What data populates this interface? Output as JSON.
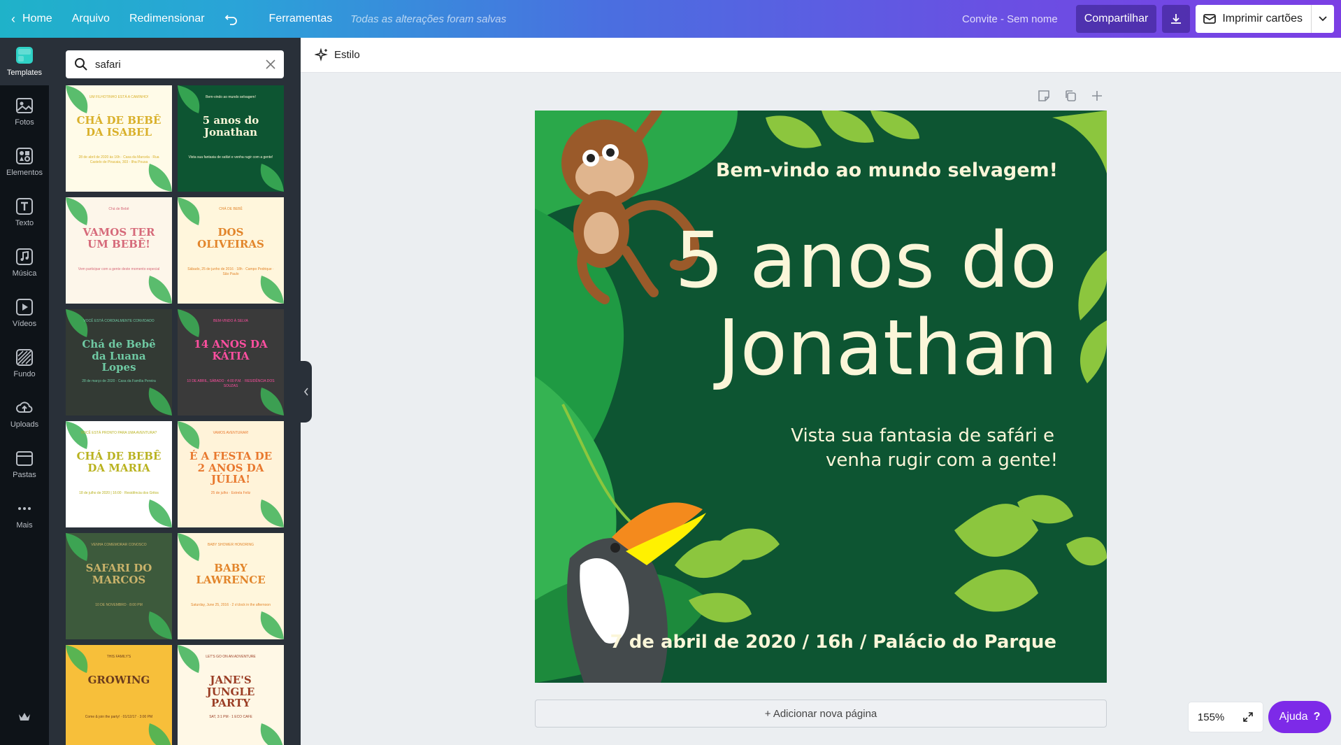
{
  "topbar": {
    "home": "Home",
    "arquivo": "Arquivo",
    "redimensionar": "Redimensionar",
    "ferramentas": "Ferramentas",
    "saved": "Todas as alterações foram salvas",
    "docname": "Convite - Sem nome",
    "share": "Compartilhar",
    "print": "Imprimir cartões"
  },
  "rail": [
    {
      "label": "Templates",
      "icon": "templates-icon"
    },
    {
      "label": "Fotos",
      "icon": "photos-icon"
    },
    {
      "label": "Elementos",
      "icon": "elements-icon"
    },
    {
      "label": "Texto",
      "icon": "text-icon"
    },
    {
      "label": "Música",
      "icon": "music-icon"
    },
    {
      "label": "Vídeos",
      "icon": "video-icon"
    },
    {
      "label": "Fundo",
      "icon": "background-icon"
    },
    {
      "label": "Uploads",
      "icon": "upload-icon"
    },
    {
      "label": "Pastas",
      "icon": "folder-icon"
    },
    {
      "label": "Mais",
      "icon": "more-icon"
    }
  ],
  "search": {
    "value": "safari"
  },
  "thumbs": [
    {
      "title": "CHÁ DE BEBÊ DA ISABEL",
      "sub": "28 de abril de 2020 às 16h · Casa da Marcela · Rua Castelo de Piracaia, 303 - Ilha Pousa",
      "top": "UM FILHOTINHO ESTÁ A CAMINHO!",
      "bg": "#fffbe8",
      "fg": "#d9b02a"
    },
    {
      "title": "5 anos do Jonathan",
      "sub": "Vista sua fantasia de safári e venha rugir com a gente!",
      "top": "Bem-vindo ao mundo selvagem!",
      "bg": "#0d5532",
      "fg": "#fbf6d9"
    },
    {
      "title": "VAMOS TER UM BEBÊ!",
      "sub": "Vem participar com a gente deste momento especial",
      "top": "Chá de Bebê",
      "bg": "#fdf6ea",
      "fg": "#d66a7a"
    },
    {
      "title": "DOS OLIVEIRAS",
      "sub": "Sábado, 25 de junho de 2016 · 18h · Campo Pedrique · São Paulo",
      "top": "CHÁ DE BEBÊ",
      "bg": "#fff6dc",
      "fg": "#e2852b"
    },
    {
      "title": "Chá de Bebê da Luana Lopes",
      "sub": "28 de março de 2020 · Casa da Família Pereira",
      "top": "VOCÊ ESTÁ CORDIALMENTE CONVIDADO",
      "bg": "#333a34",
      "fg": "#6fc9a3"
    },
    {
      "title": "14 ANOS DA KÁTIA",
      "sub": "10 DE ABRIL, SÁBADO · 4:00 P.M. · RESIDÊNCIA DOS SOUZAS",
      "top": "BEM-VINDO À SELVA",
      "bg": "#3a3a3a",
      "fg": "#ff4fa0"
    },
    {
      "title": "CHÁ DE BEBÊ DA MARIA",
      "sub": "18 de julho de 2020 | 16:00 · Residência dos Gritos",
      "top": "VOCÊ ESTÁ PRONTO PARA UMA AVENTURA?",
      "bg": "#ffffff",
      "fg": "#b9b21f"
    },
    {
      "title": "É A FESTA DE 2 ANOS DA JÚLIA!",
      "sub": "25 de julho · Estrela Feliz",
      "top": "VAMOS AVENTURAR!",
      "bg": "#fff3d9",
      "fg": "#e8782e"
    },
    {
      "title": "SAFARI DO MARCOS",
      "sub": "10 DE NOVEMBRO · 8:00 PM",
      "top": "VENHA COMEMORAR CONOSCO",
      "bg": "#3d5a3c",
      "fg": "#c9b26a"
    },
    {
      "title": "BABY LAWRENCE",
      "sub": "Saturday, June 25, 2016 · 2 o'clock in the afternoon",
      "top": "BABY SHOWER HONORING",
      "bg": "#fff6dc",
      "fg": "#e2852b"
    },
    {
      "title": "GROWING",
      "sub": "Come & join the party! · 01/12/17 · 3:00 PM",
      "top": "THIS FAMILY'S",
      "bg": "#f7bf3a",
      "fg": "#6b3c1d"
    },
    {
      "title": "JANE'S JUNGLE PARTY",
      "sub": "SAT, 3:1 PM · 1 ECO CAFE",
      "top": "LET'S GO ON AN ADVENTURE",
      "bg": "#fff8e6",
      "fg": "#9a3d24"
    }
  ],
  "stylebar": {
    "label": "Estilo"
  },
  "card": {
    "welcome": "Bem-vindo ao mundo selvagem!",
    "line1": "5 anos do",
    "line2": "Jonathan",
    "body1": "Vista sua fantasia de safári e",
    "body2": "venha rugir com a gente!",
    "date": "7 de abril de 2020 / 16h / Palácio do Parque"
  },
  "addpage": "+ Adicionar nova página",
  "zoom": "155%",
  "help": "Ajuda",
  "help_icon": "?"
}
